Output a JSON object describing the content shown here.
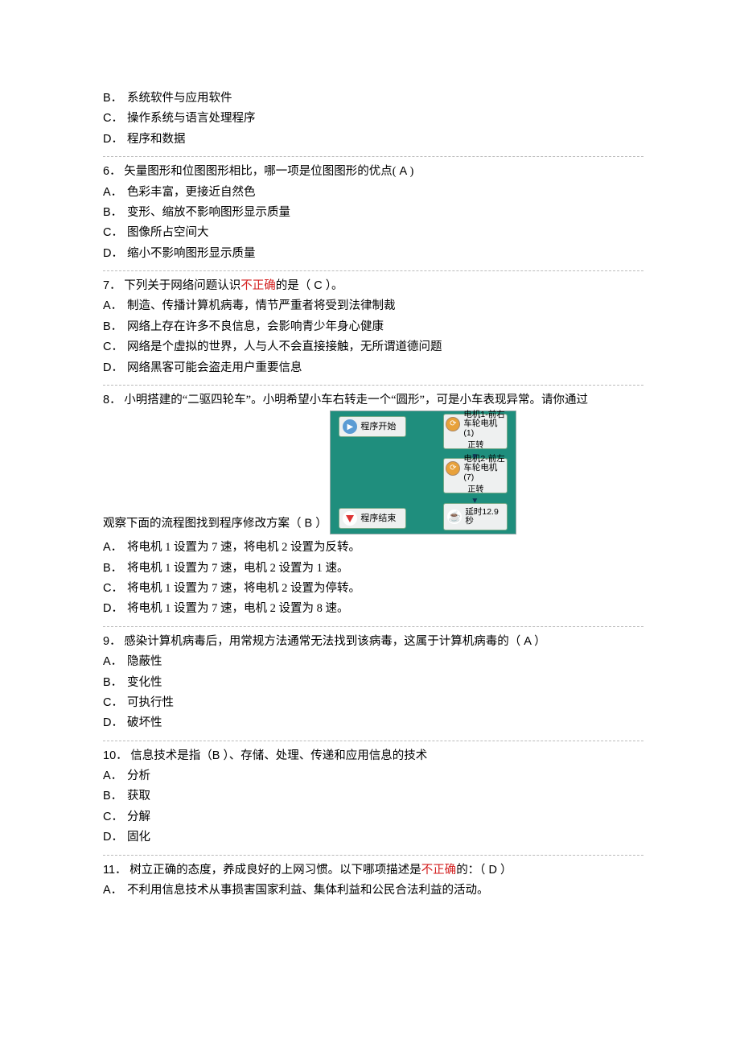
{
  "q5_tail": {
    "B": "系统软件与应用软件",
    "C": "操作系统与语言处理程序",
    "D": "程序和数据"
  },
  "q6": {
    "num": "6．",
    "stem_a": "矢量图形和位图图形相比，哪一项是位图图形的优点(",
    "ans": " A ",
    "stem_b": ")",
    "A": "色彩丰富，更接近自然色",
    "B": "变形、缩放不影响图形显示质量",
    "C": "图像所占空间大",
    "D": "缩小不影响图形显示质量"
  },
  "q7": {
    "num": "7．",
    "stem_a": "下列关于网络问题认识",
    "wrong": "不正确",
    "stem_b": "的是（",
    "ans": " C ",
    "stem_c": "）。",
    "A": "制造、传播计算机病毒，情节严重者将受到法律制裁",
    "B": "网络上存在许多不良信息，会影响青少年身心健康",
    "C": "网络是个虚拟的世界，人与人不会直接接触，无所谓道德问题",
    "D": "网络黑客可能会盗走用户重要信息"
  },
  "q8": {
    "num": "8．",
    "stem_top": "小明搭建的“二驱四轮车”。小明希望小车右转走一个“圆形”，可是小车表现异常。请你通过",
    "stem_bot_a": "观察下面的流程图找到程序修改方案（",
    "ans": " B ",
    "stem_bot_b": "）",
    "A": "将电机 1 设置为 7 速，将电机 2 设置为反转。",
    "B": "将电机 1 设置为 7 速，电机 2 设置为 1 速。",
    "C": "将电机 1 设置为 7 速，将电机 2 设置为停转。",
    "D": "将电机 1 设置为 7 速，电机 2 设置为 8 速。",
    "dg": {
      "start": "程序开始",
      "end": "程序结束",
      "m1a": "电机1-前右",
      "m1b": "车轮电机(1)",
      "m1c": "正转",
      "m2a": "电机2-前左",
      "m2b": "车轮电机(7)",
      "m2c": "正转",
      "d1": "延时12.9",
      "d2": "秒"
    }
  },
  "q9": {
    "num": "9．",
    "stem_a": "感染计算机病毒后，用常规方法通常无法找到该病毒，这属于计算机病毒的（",
    "ans": " A ",
    "stem_b": "）",
    "A": "隐蔽性",
    "B": "变化性",
    "C": "可执行性",
    "D": "破坏性"
  },
  "q10": {
    "num": "10．",
    "stem_a": "信息技术是指（",
    "ans": "B ",
    "stem_b": "）、存储、处理、传递和应用信息的技术",
    "A": "分析",
    "B": "获取",
    "C": "分解",
    "D": "固化"
  },
  "q11": {
    "num": "11．",
    "stem_a": "树立正确的态度，养成良好的上网习惯。以下哪项描述是",
    "wrong": "不正确",
    "stem_b": "的：（",
    "ans": " D ",
    "stem_c": "）",
    "A": "不利用信息技术从事损害国家利益、集体利益和公民合法利益的活动。"
  }
}
